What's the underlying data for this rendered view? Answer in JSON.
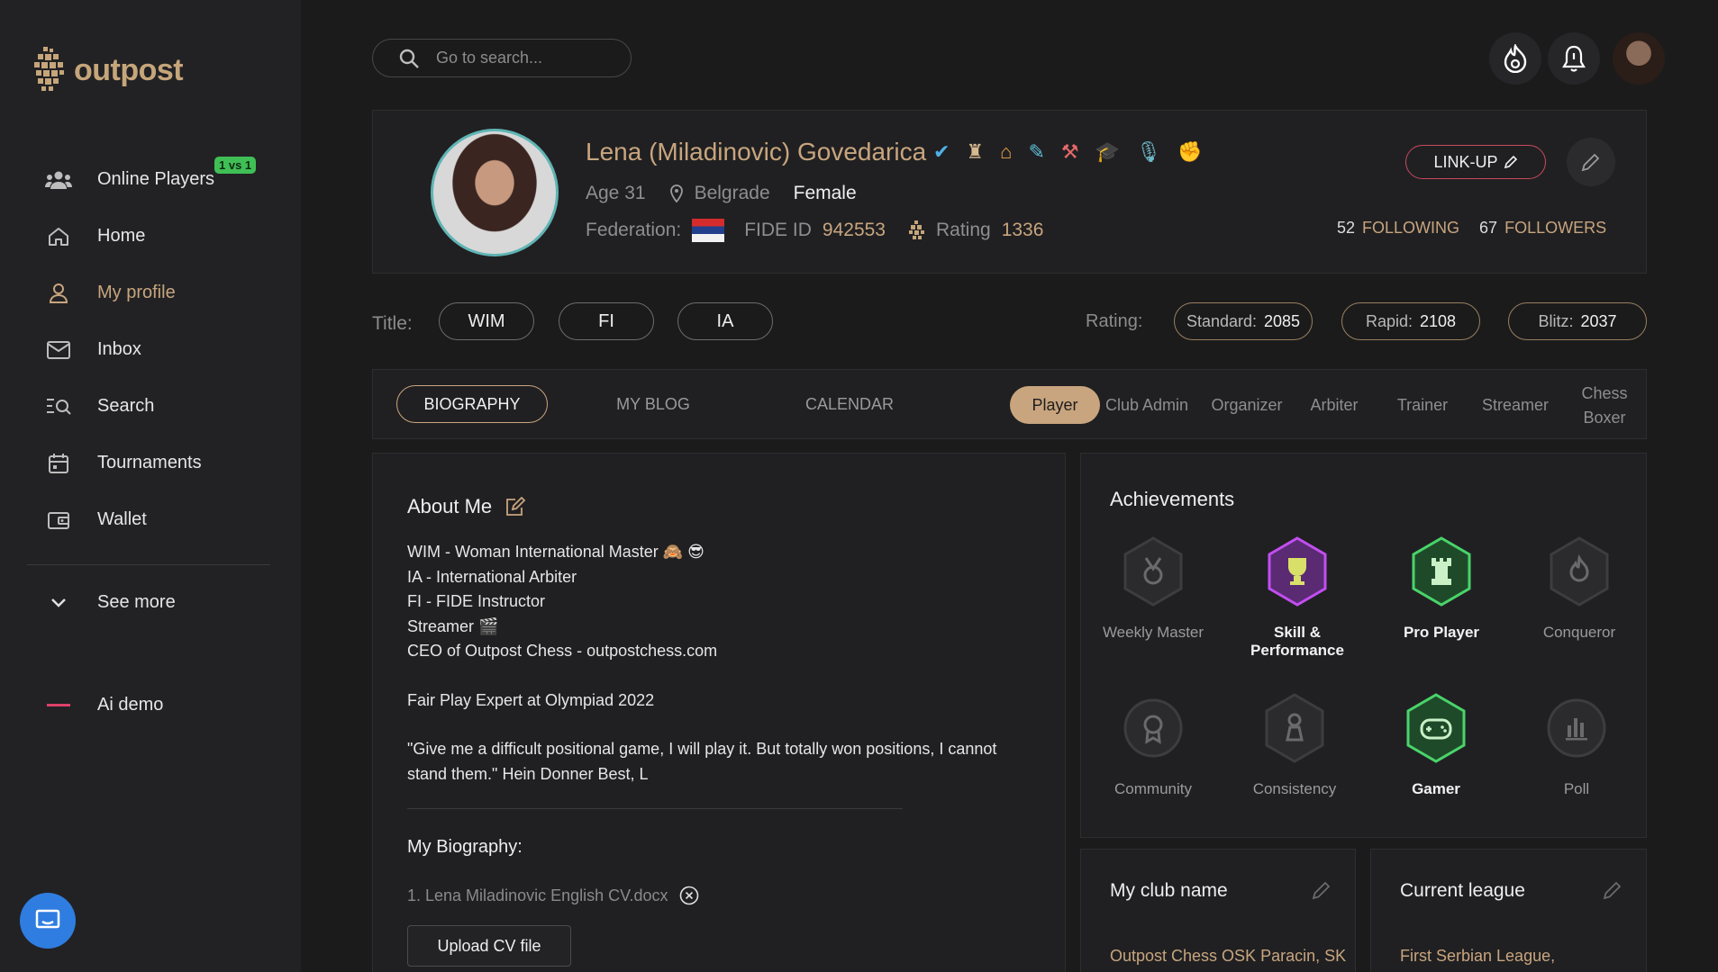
{
  "brand": {
    "name": "outpost"
  },
  "sidebar": {
    "items": [
      {
        "label": "Online Players",
        "icon": "users-icon",
        "badge": "1 vs 1"
      },
      {
        "label": "Home",
        "icon": "home-icon"
      },
      {
        "label": "My profile",
        "icon": "user-icon",
        "active": true
      },
      {
        "label": "Inbox",
        "icon": "mail-icon"
      },
      {
        "label": "Search",
        "icon": "search-list-icon"
      },
      {
        "label": "Tournaments",
        "icon": "calendar-icon"
      },
      {
        "label": "Wallet",
        "icon": "wallet-icon"
      }
    ],
    "see_more": "See more",
    "ai_demo": "Ai demo"
  },
  "search": {
    "placeholder": "Go to search..."
  },
  "profile": {
    "name": "Lena (Miladinovic) Govedarica",
    "age": "Age 31",
    "city": "Belgrade",
    "gender": "Female",
    "federation_label": "Federation:",
    "fide_label": "FIDE ID",
    "fide_id": "942553",
    "rating_label": "Rating",
    "rating": "1336",
    "linkup": "LINK-UP",
    "following_count": "52",
    "following_label": "FOLLOWING",
    "followers_count": "67",
    "followers_label": "FOLLOWERS"
  },
  "titles": {
    "label": "Title:",
    "items": [
      "WIM",
      "FI",
      "IA"
    ]
  },
  "ratings": {
    "label": "Rating:",
    "items": [
      {
        "key": "Standard:",
        "value": "2085"
      },
      {
        "key": "Rapid:",
        "value": "2108"
      },
      {
        "key": "Blitz:",
        "value": "2037"
      }
    ]
  },
  "tabs": [
    "BIOGRAPHY",
    "MY BLOG",
    "CALENDAR"
  ],
  "roles": [
    "Player",
    "Club Admin",
    "Organizer",
    "Arbiter",
    "Trainer",
    "Streamer",
    "Chess Boxer"
  ],
  "about": {
    "title": "About Me",
    "lines": [
      "WIM - Woman International Master 🙈 😎",
      "IA - International Arbiter",
      "FI - FIDE Instructor",
      "Streamer 🎬",
      "CEO of Outpost Chess - outpostchess.com",
      "Fair Play Expert at Olympiad 2022",
      "\"Give me a difficult positional game, I will play it. But totally won positions, I cannot stand them.\" Hein Donner Best, L"
    ],
    "bio_title": "My Biography:",
    "cv_file": "1. Lena Miladinovic English CV.docx",
    "upload_label": "Upload CV file"
  },
  "achievements": {
    "title": "Achievements",
    "items": [
      {
        "label": "Weekly Master",
        "icon": "medal-icon",
        "active": false
      },
      {
        "label": "Skill & Performance",
        "icon": "trophy-icon",
        "active": true,
        "color": "#b43fd6"
      },
      {
        "label": "Pro Player",
        "icon": "rook-icon",
        "active": true,
        "color": "#3fbf55"
      },
      {
        "label": "Conqueror",
        "icon": "flame-icon",
        "active": false
      },
      {
        "label": "Community",
        "icon": "award-icon",
        "active": false
      },
      {
        "label": "Consistency",
        "icon": "pawn-icon",
        "active": false
      },
      {
        "label": "Gamer",
        "icon": "gamepad-icon",
        "active": true,
        "color": "#3fbf55"
      },
      {
        "label": "Poll",
        "icon": "bar-chart-icon",
        "active": false
      }
    ]
  },
  "club": {
    "title": "My club name",
    "value": "Outpost Chess OSK Paracin, SK"
  },
  "league": {
    "title": "Current league",
    "value": "First Serbian League,"
  },
  "colors": {
    "accent": "#c8a57e",
    "link_border": "#c84a5c",
    "badge_green": "#3fbf55",
    "ai_demo": "#e0406a"
  }
}
